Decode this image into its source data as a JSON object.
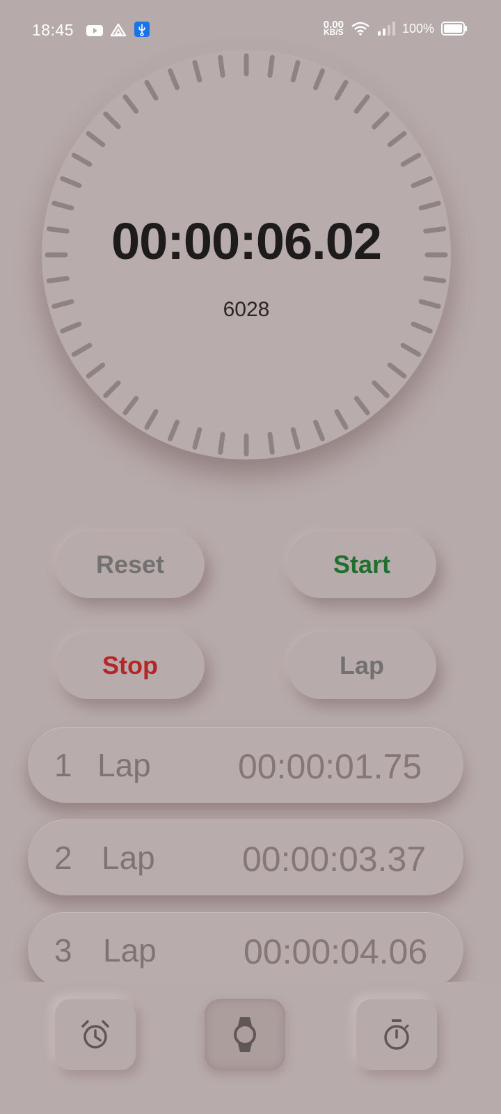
{
  "status_bar": {
    "time": "18:45",
    "net_speed_value": "0.00",
    "net_speed_unit": "KB/S",
    "battery_percent": "100%"
  },
  "stopwatch": {
    "elapsed": "00:00:06.02",
    "milliseconds": "6028"
  },
  "buttons": {
    "reset": "Reset",
    "start": "Start",
    "stop": "Stop",
    "lap": "Lap"
  },
  "laps": [
    {
      "number": "1",
      "label": "Lap",
      "time": "00:00:01.75"
    },
    {
      "number": "2",
      "label": "Lap",
      "time": "00:00:03.37"
    },
    {
      "number": "3",
      "label": "Lap",
      "time": "00:00:04.06"
    }
  ],
  "nav": {
    "items": [
      {
        "icon": "alarm-clock-icon",
        "active": false
      },
      {
        "icon": "watch-icon",
        "active": true
      },
      {
        "icon": "stopwatch-icon",
        "active": false
      }
    ]
  },
  "colors": {
    "background": "#b7aaaa",
    "start": "#1f6f2e",
    "stop": "#b5262a",
    "neutral_button": "#737070"
  }
}
